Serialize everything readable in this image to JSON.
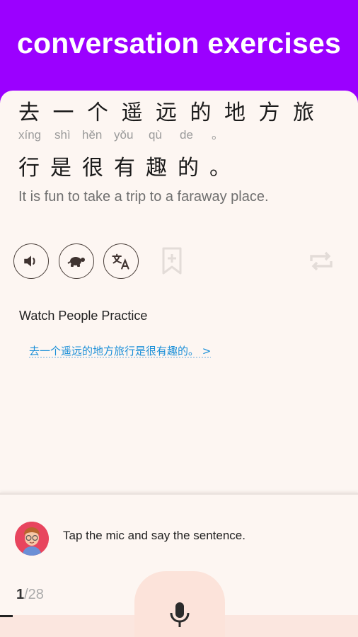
{
  "banner": {
    "title": "conversation exercises"
  },
  "sentence": {
    "line1_chars": [
      "去",
      "一",
      "个",
      "遥",
      "远",
      "的",
      "地",
      "方",
      "旅"
    ],
    "pinyin": [
      "xíng",
      "shì",
      "hěn",
      "yǒu",
      "qù",
      "de",
      "。"
    ],
    "line2_chars": [
      "行",
      "是",
      "很",
      "有",
      "趣",
      "的",
      "。"
    ],
    "translation": "It is fun to take a trip to a faraway place."
  },
  "toolbar": {
    "icons": [
      "speaker-icon",
      "turtle-icon",
      "translate-icon",
      "bookmark-add-icon",
      "repeat-icon"
    ]
  },
  "practice": {
    "heading": "Watch People Practice",
    "link_text": "去一个遥远的地方旅行是很有趣的。 >"
  },
  "bottom": {
    "prompt": "Tap the mic and say the sentence.",
    "progress_current": "1",
    "progress_total": "/28",
    "progress_fraction": 0.0357
  },
  "colors": {
    "accent": "#9b00ff",
    "background": "#fdf6f2",
    "link": "#1a8fd8",
    "mic_bg": "#fce3da"
  }
}
